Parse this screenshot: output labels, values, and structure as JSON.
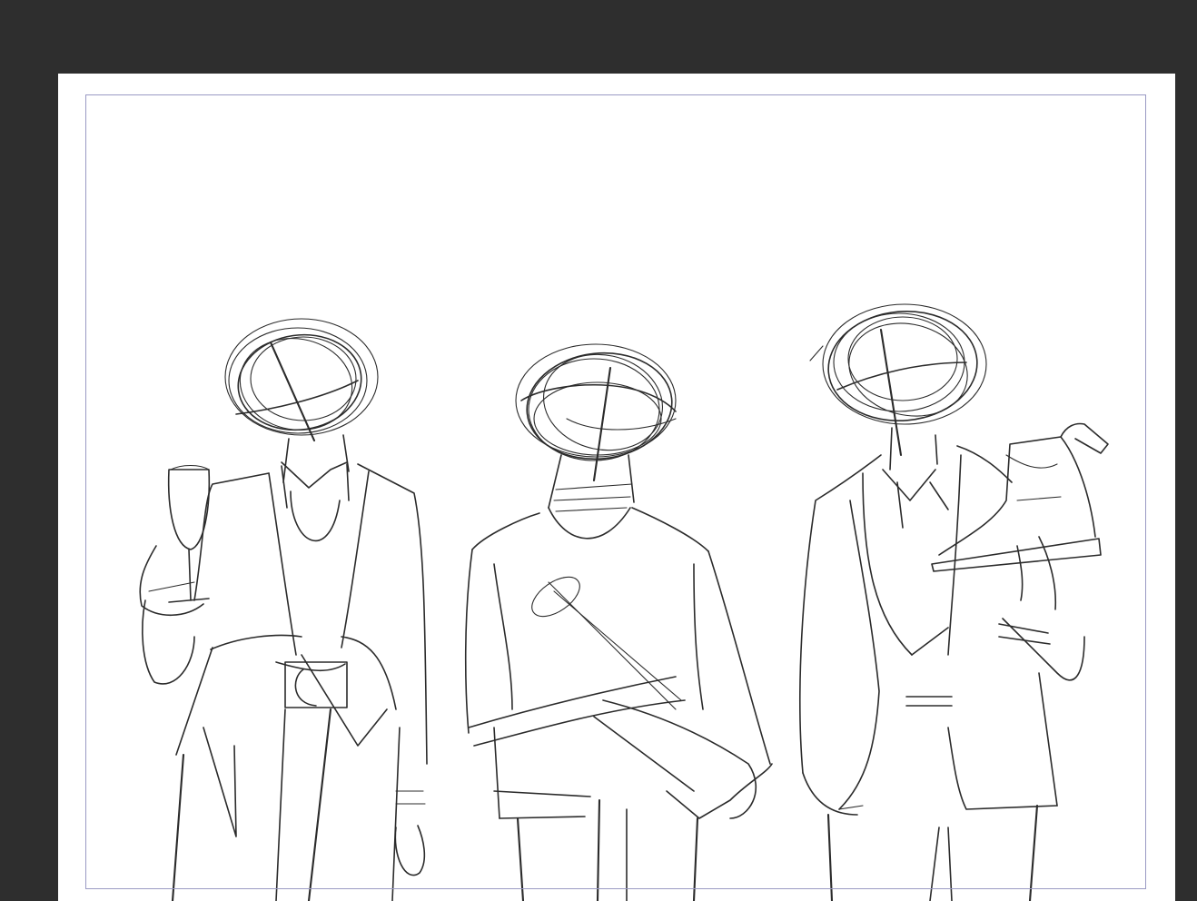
{
  "app": {
    "background_color": "#2e2e2e",
    "canvas_color": "#ffffff",
    "frame_color": "#9a9ac4"
  },
  "sketch": {
    "figures": [
      {
        "name": "figure-left",
        "prop": "champagne-glass"
      },
      {
        "name": "figure-center",
        "prop": "none"
      },
      {
        "name": "figure-right",
        "prop": "boot"
      }
    ]
  }
}
